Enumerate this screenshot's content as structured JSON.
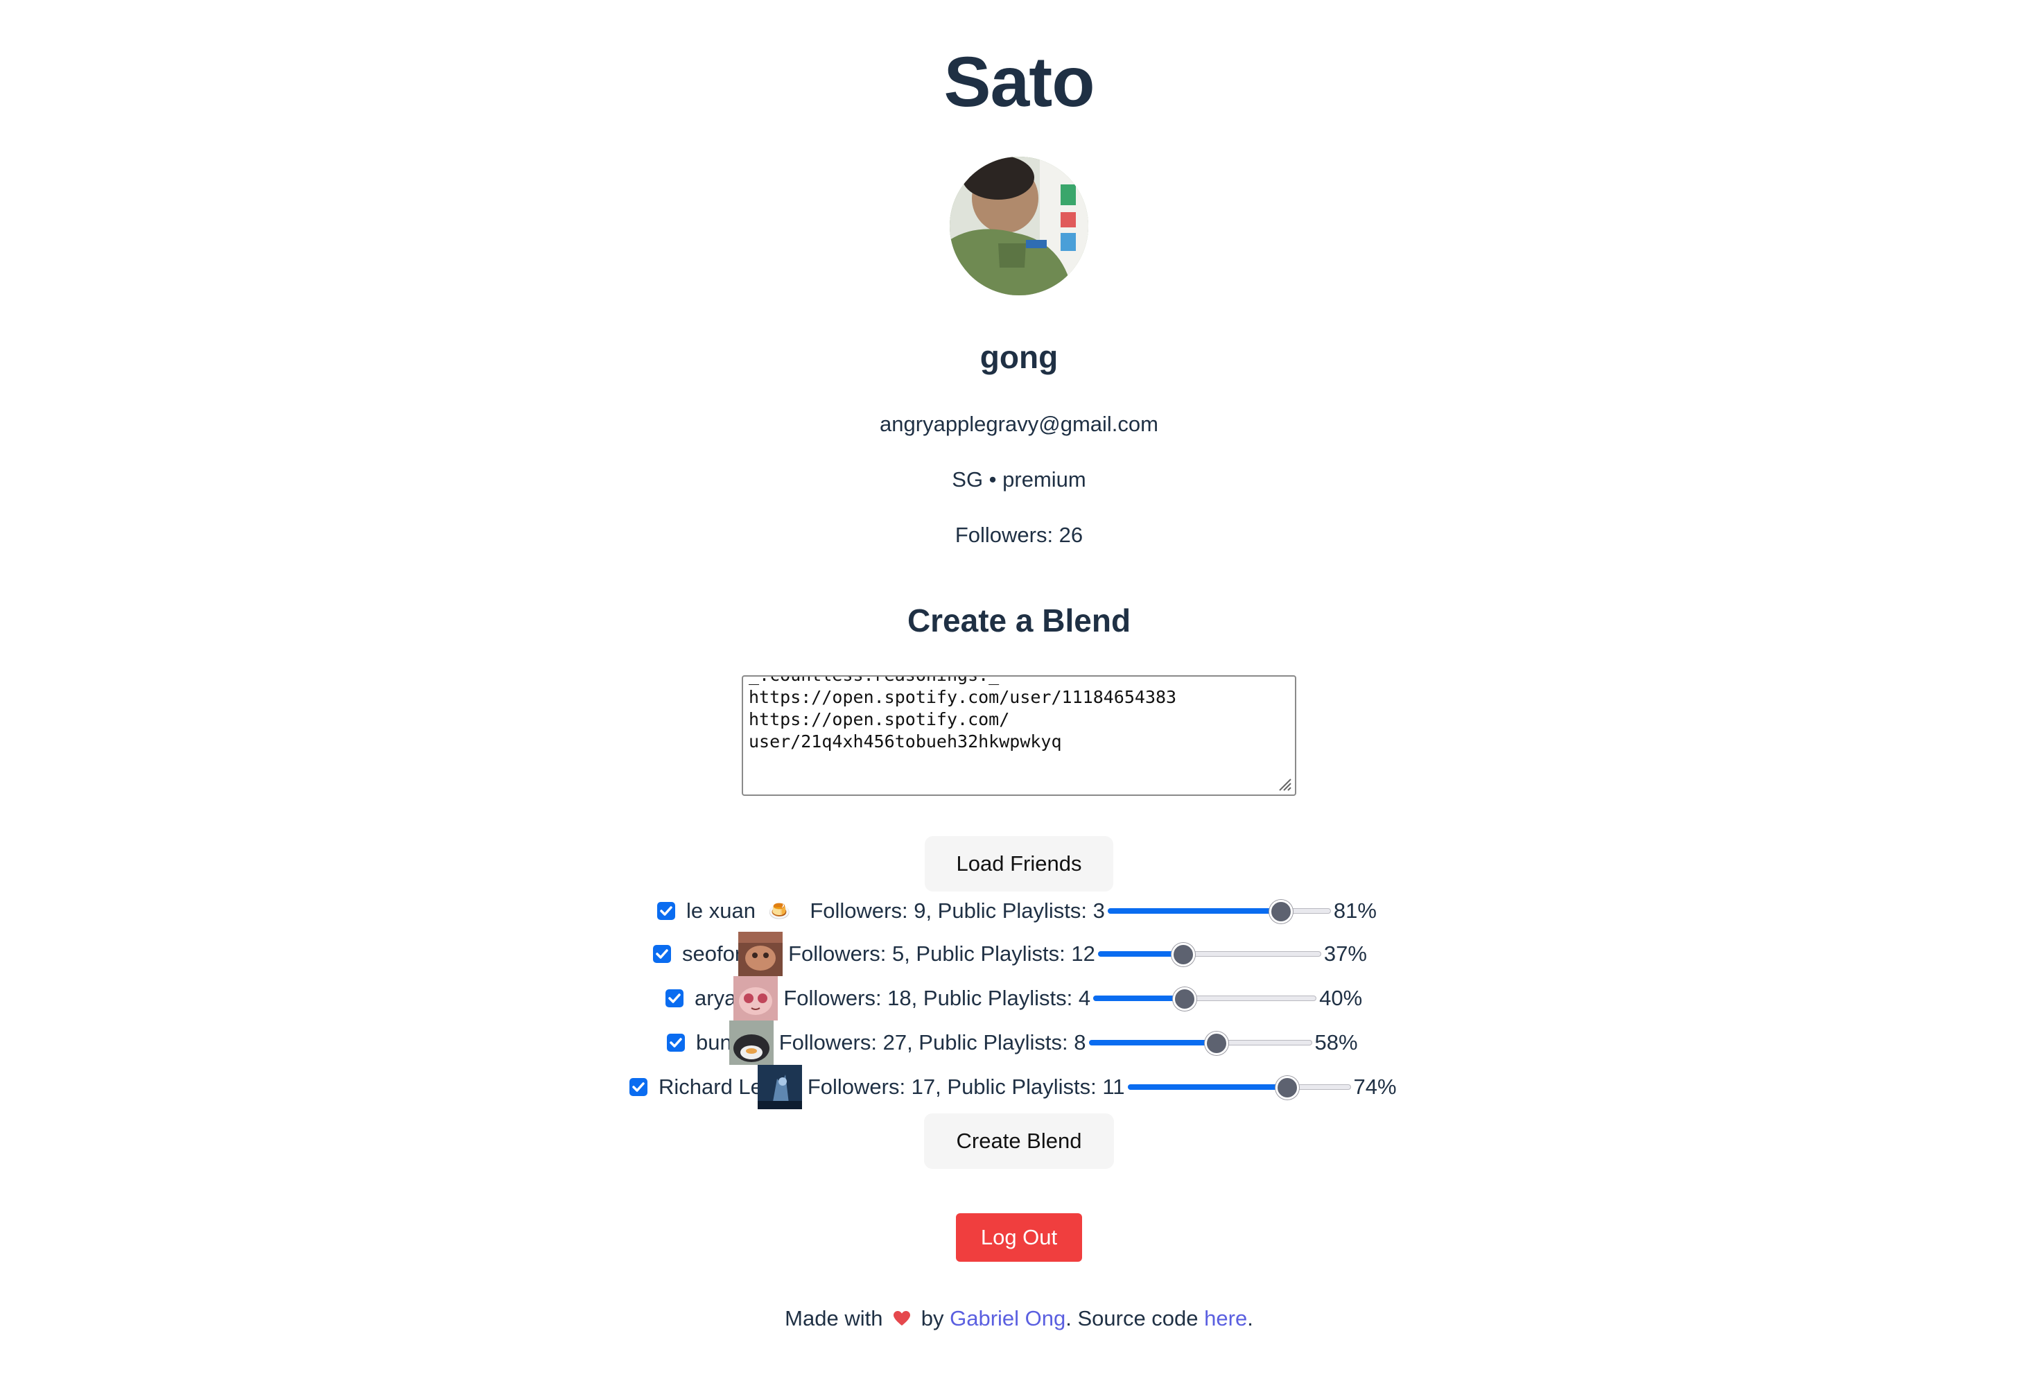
{
  "app_title": "Sato",
  "profile": {
    "display_name": "gong",
    "email": "angryapplegravy@gmail.com",
    "country_plan": "SG • premium",
    "followers": "Followers: 26"
  },
  "blend": {
    "heading": "Create a Blend",
    "textarea_value": "_.countless.reasonings._\nhttps://open.spotify.com/user/11184654383\nhttps://open.spotify.com/\nuser/21q4xh456tobueh32hkwpwkyq",
    "load_button": "Load Friends",
    "create_button": "Create Blend"
  },
  "friends": [
    {
      "name": "le xuan",
      "emoji": "🍮",
      "stats": "Followers: 9, Public Playlists: 3",
      "weight": 0.81,
      "pct": "81%",
      "checked": true
    },
    {
      "name": "seofon",
      "stats": "Followers: 5, Public Playlists: 12",
      "weight": 0.37,
      "pct": "37%",
      "checked": true
    },
    {
      "name": "arya",
      "stats": "Followers: 18, Public Playlists: 4",
      "weight": 0.4,
      "pct": "40%",
      "checked": true
    },
    {
      "name": "bun",
      "stats": "Followers: 27, Public Playlists: 8",
      "weight": 0.58,
      "pct": "58%",
      "checked": true
    },
    {
      "name": "Richard Lei",
      "stats": "Followers: 17, Public Playlists: 11",
      "weight": 0.74,
      "pct": "74%",
      "checked": true
    }
  ],
  "logout_button": "Log Out",
  "footer": {
    "made_with": "Made with",
    "by": "by",
    "author": "Gabriel Ong",
    "source_prefix": ". Source code",
    "source_link": "here",
    "end": "."
  },
  "colors": {
    "accent": "#0a6cf0",
    "danger": "#f03e3e",
    "link": "#5a5fe0",
    "heart": "#e5484d"
  },
  "icons": [
    "heart-icon",
    "checkbox-checked-icon",
    "resize-grip-icon"
  ]
}
